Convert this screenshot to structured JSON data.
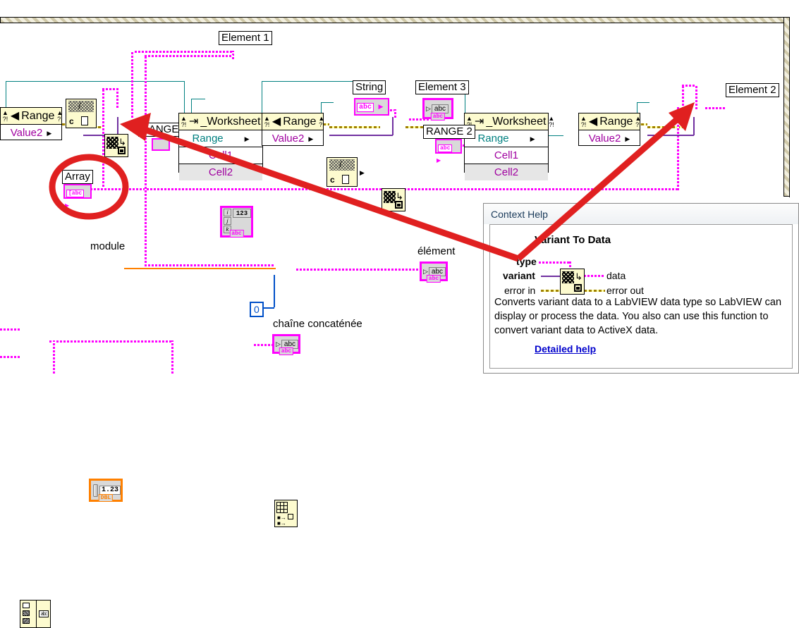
{
  "diagram": {
    "labels": {
      "element1": "Element 1",
      "element2": "Element 2",
      "element3": "Element 3",
      "string": "String",
      "array": "Array",
      "range3": "RANGE 3",
      "range2": "RANGE 2",
      "module": "module",
      "element_fr": "élément",
      "chaine": "chaîne concaténée"
    },
    "nodes": {
      "worksheet": "_Worksheet",
      "range": "Range",
      "value2": "Value2",
      "range_prop": "Range",
      "cell1": "Cell1",
      "cell2": "Cell2"
    },
    "constants": {
      "zero": "0",
      "abc": "abc",
      "numeric_display": "123",
      "dbl_value": "1.23",
      "dbl_type": "DBL",
      "string_type": "abc",
      "array_type": "[abc",
      "index_i": "i",
      "index_j": "j",
      "index_k": "k",
      "c_letter": "c"
    },
    "colors": {
      "variant_wire": "#ff00ff",
      "refnum_wire": "#008080",
      "error_wire": "#a08000",
      "dbl_orange": "#ff8000",
      "numeric_blue": "#0050c8",
      "node_yellow": "#fdfbcf",
      "annotation_red": "#e02020"
    }
  },
  "context_help": {
    "window_title": "Context Help",
    "function_title": "Variant To Data",
    "terminals": {
      "type": "type",
      "variant": "variant",
      "error_in": "error in",
      "data": "data",
      "error_out": "error out"
    },
    "description": "Converts variant data to a LabVIEW data type so LabVIEW can display or process the data. You also can use this function to convert variant data to ActiveX data.",
    "detailed_help": "Detailed help"
  },
  "annotations": {
    "circle_target": "Array",
    "arrow1_target": "variant-to-data-left",
    "arrow2_target": "variant-to-data-right"
  }
}
